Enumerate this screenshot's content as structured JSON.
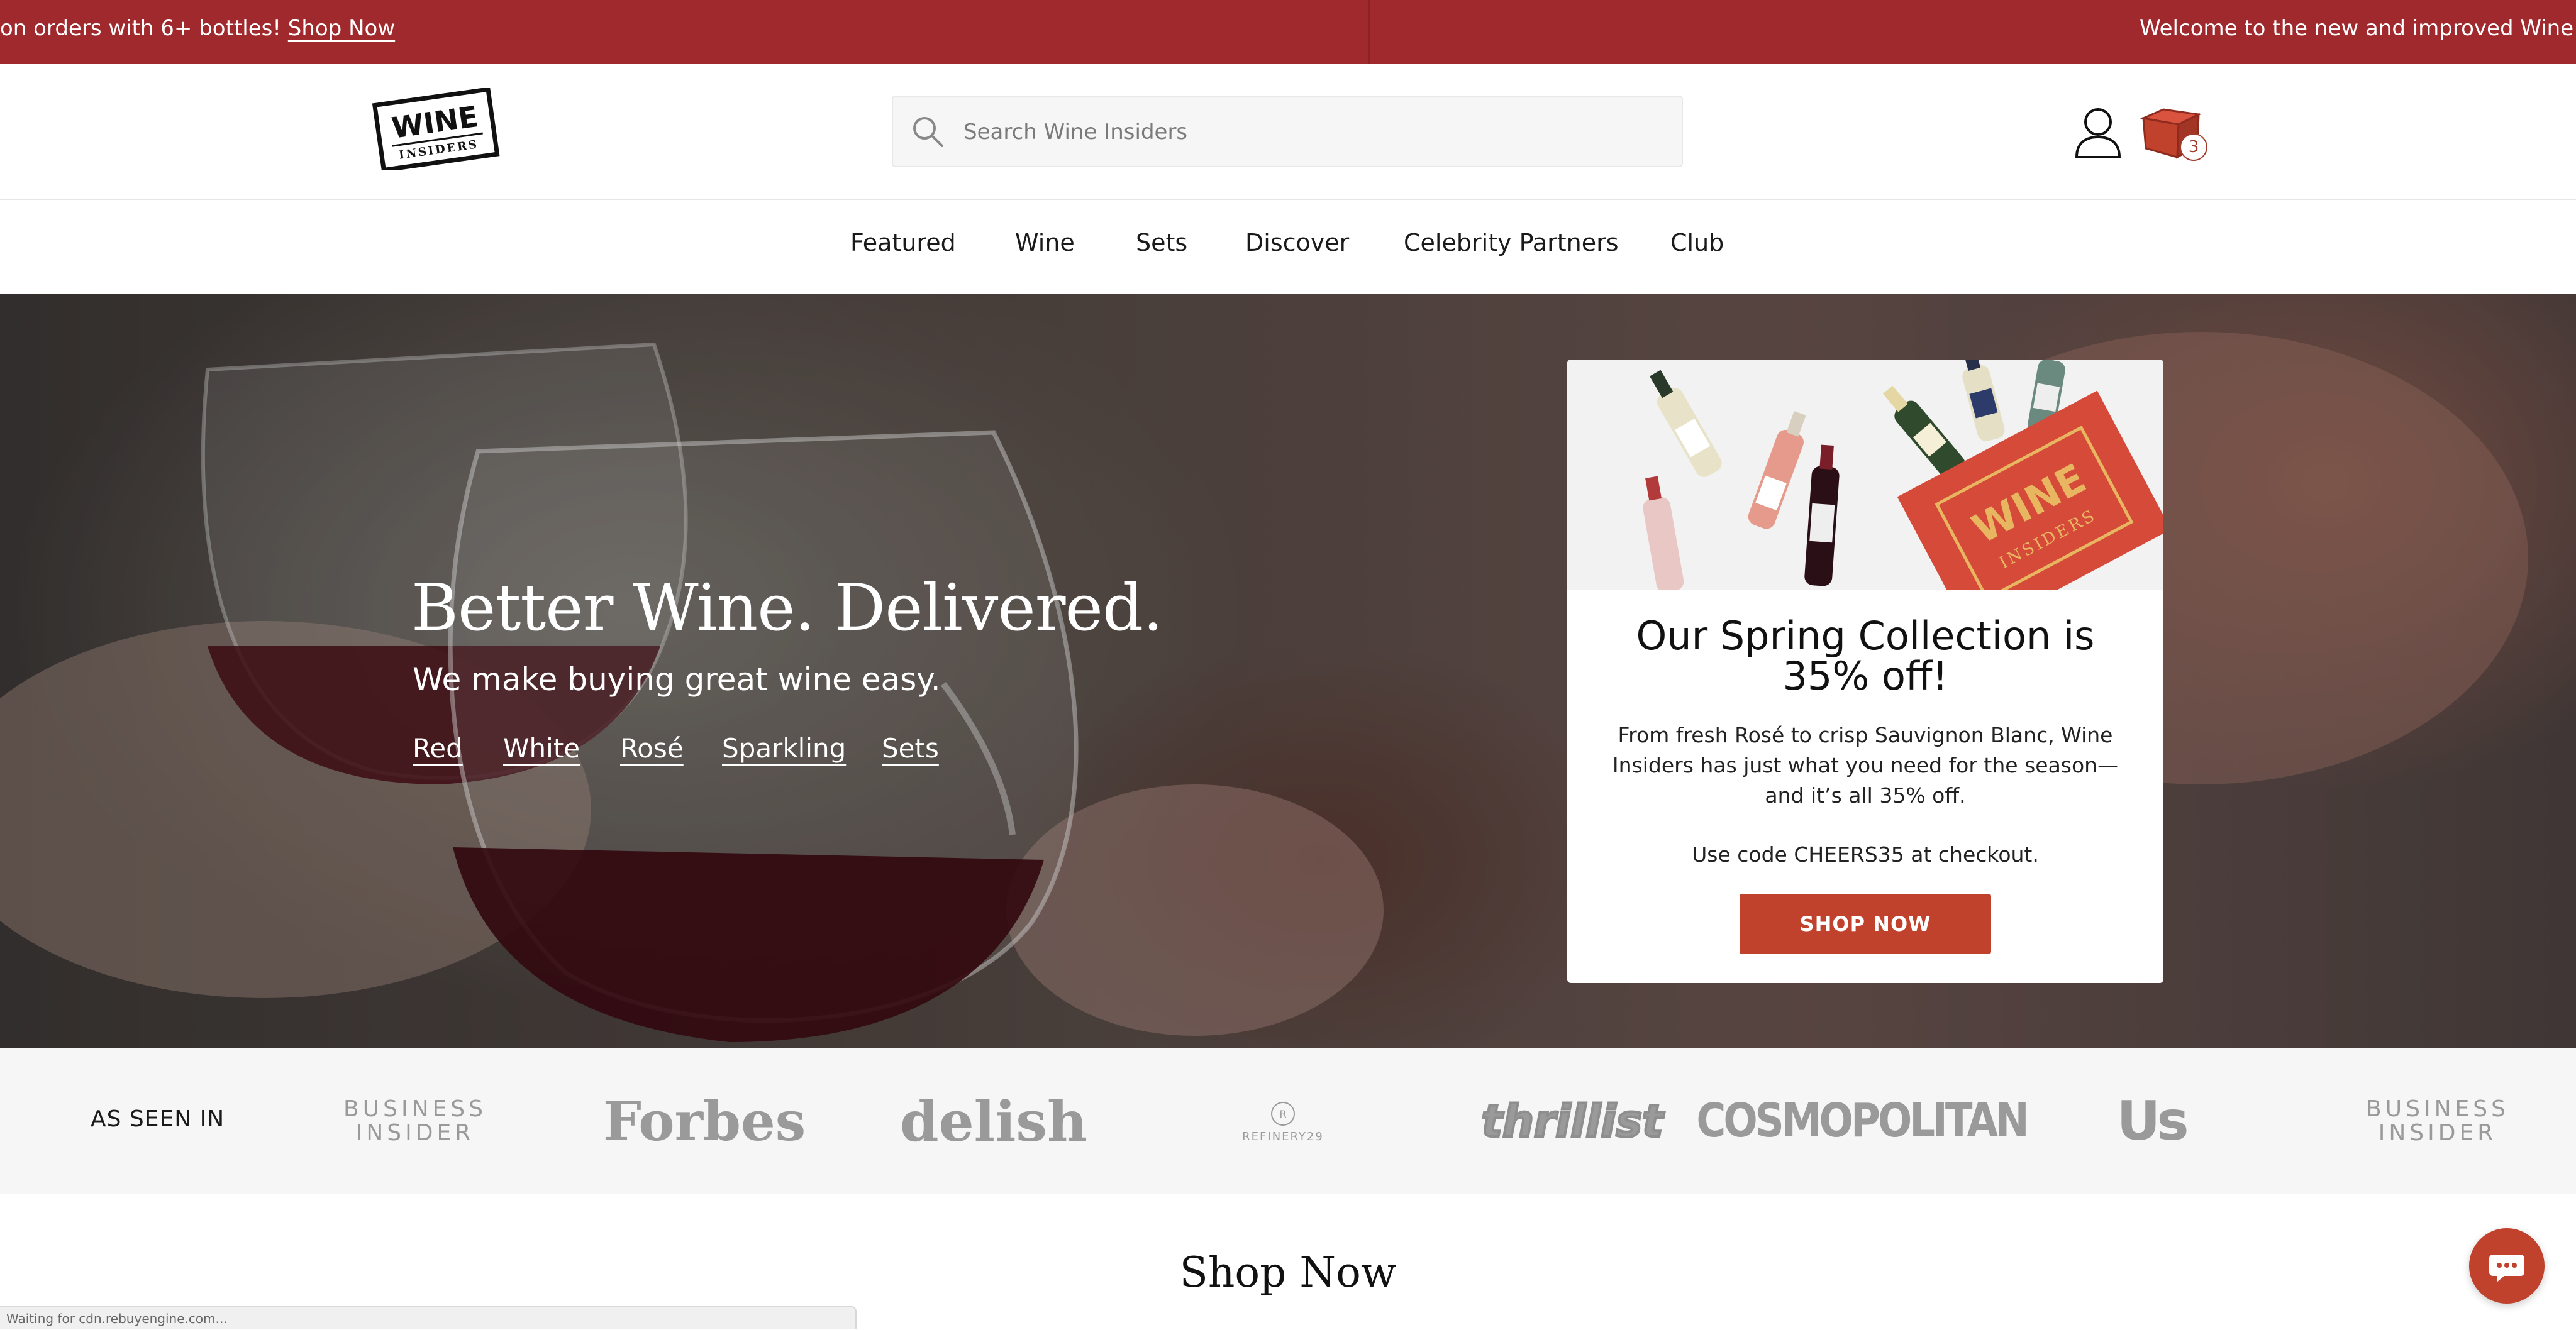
{
  "announcement": {
    "left_text": "on orders with 6+ bottles!",
    "left_link": "Shop Now",
    "right_text": "Welcome to the new and improved Wine In"
  },
  "header": {
    "logo_line1": "WINE",
    "logo_line2": "INSIDERS",
    "search_placeholder": "Search Wine Insiders",
    "cart_count": "3"
  },
  "nav": {
    "items": [
      "Featured",
      "Wine",
      "Sets",
      "Discover",
      "Celebrity Partners",
      "Club"
    ]
  },
  "hero": {
    "title": "Better Wine. Delivered.",
    "subtitle": "We make buying great wine easy.",
    "links": [
      "Red",
      "White",
      "Rosé",
      "Sparkling",
      "Sets"
    ]
  },
  "promo": {
    "title": "Our Spring Collection is 35% off!",
    "body": "From fresh Rosé to crisp Sauvignon Blanc, Wine Insiders has just what you need for the season—and it’s all 35% off.",
    "code_text": "Use code CHEERS35 at checkout.",
    "button": "SHOP NOW",
    "box_logo_line1": "WINE",
    "box_logo_line2": "INSIDERS"
  },
  "press": {
    "label": "AS SEEN IN",
    "logos": {
      "business_insider_1": "BUSINESS",
      "business_insider_2": "INSIDER",
      "forbes": "Forbes",
      "delish": "delish",
      "refinery29": "REFINERY29",
      "thrillist": "thrillist",
      "cosmopolitan": "COSMOPOLITAN",
      "us": "Us"
    }
  },
  "section": {
    "title": "Shop Now"
  },
  "status_bar": {
    "text": "Waiting for cdn.rebuyengine.com..."
  },
  "colors": {
    "brand_red": "#a0292d",
    "button_red": "#c0412c"
  }
}
